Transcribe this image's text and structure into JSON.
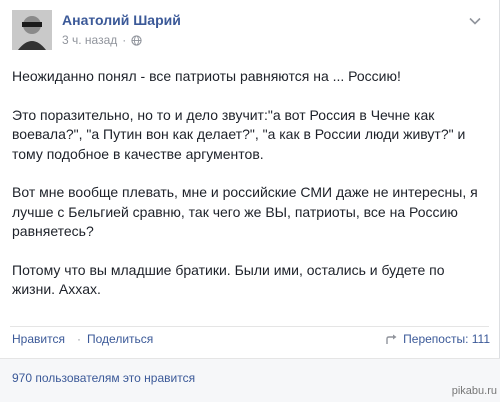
{
  "post": {
    "author": "Анатолий Шарий",
    "time": "3 ч. назад",
    "meta_separator": "·",
    "paragraphs": [
      "Неожиданно понял - все патриоты равняются на ... Россию!",
      "Это поразительно, но то и дело звучит:\"а вот Россия в Чечне как воевала?\", \"а Путин вон как делает?\", \"а как в России люди живут?\" и тому подобное в качестве аргументов.",
      "Вот мне вообще плевать, мне и российские СМИ даже не интересны, я лучше с Бельгией сравню, так чего же ВЫ, патриоты, все на Россию равняетесь?",
      "Потому что вы младшие братики. Были ими, остались и будете по жизни. Ахxах."
    ]
  },
  "actions": {
    "like": "Нравится",
    "dot": "·",
    "share": "Поделиться",
    "reposts": "Перепосты: 111"
  },
  "likes": {
    "text": "970 пользователям это нравится"
  },
  "watermark": "pikabu.ru",
  "icons": {
    "avatar": "avatar-photo",
    "globe": "globe-icon",
    "chevron": "chevron-down-icon",
    "share": "share-icon"
  }
}
